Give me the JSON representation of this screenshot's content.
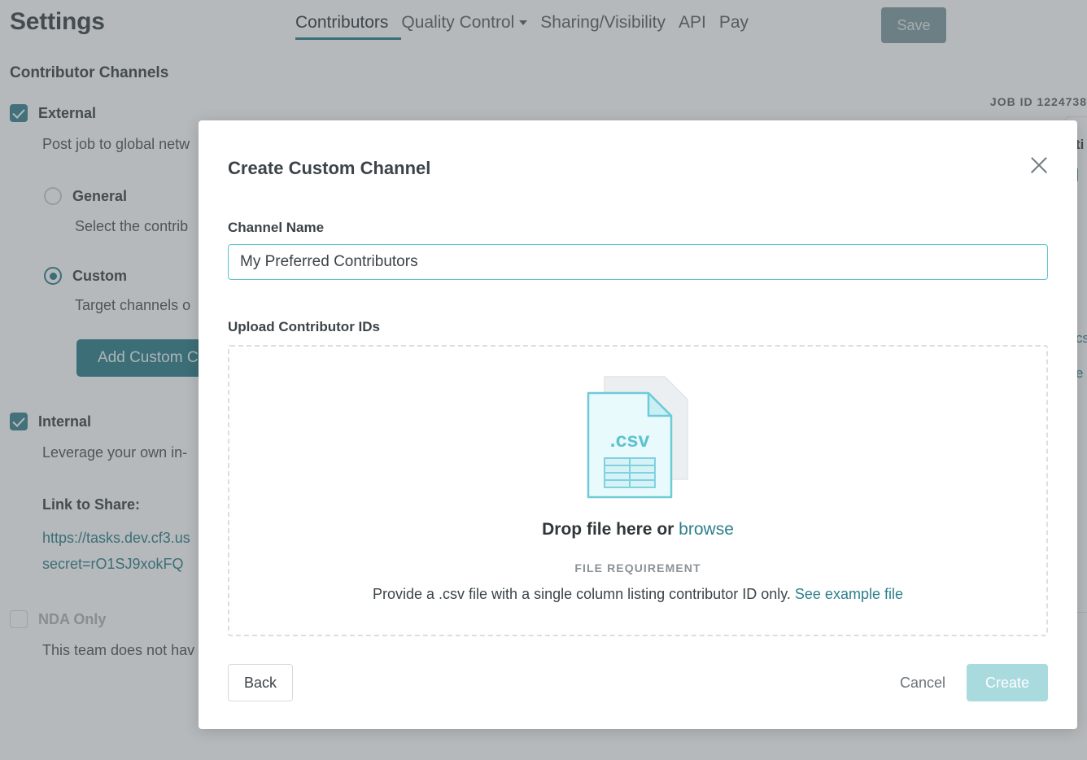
{
  "page": {
    "title": "Settings",
    "section_title": "Contributor Channels",
    "job_id": "JOB ID 1224738",
    "save_label": "Save",
    "accent_color": "#2d7f8c",
    "scrim_color": "#50595e"
  },
  "tabs": [
    {
      "label": "Contributors",
      "active": true,
      "caret": false
    },
    {
      "label": "Quality Control",
      "active": false,
      "caret": true
    },
    {
      "label": "Sharing/Visibility",
      "active": false,
      "caret": false
    },
    {
      "label": "API",
      "active": false,
      "caret": false
    },
    {
      "label": "Pay",
      "active": false,
      "caret": false
    }
  ],
  "background": {
    "external": {
      "label": "External",
      "checked": true,
      "desc": "Post job to global netw"
    },
    "general": {
      "label": "General",
      "selected": false,
      "desc": "Select the contrib"
    },
    "custom": {
      "label": "Custom",
      "selected": true,
      "desc": "Target channels o"
    },
    "add_custom_button": "Add Custom Ch",
    "internal": {
      "label": "Internal",
      "checked": true,
      "desc": "Leverage your own in-"
    },
    "link_to_share_label": "Link to Share:",
    "share_link_line1": "https://tasks.dev.cf3.us",
    "share_link_line2": "secret=rO1SJ9xokFQ",
    "nda_only": {
      "label": "NDA Only",
      "checked": false,
      "desc": "This team does not hav"
    },
    "right_panel": {
      "line1": "ti",
      "line2": "|",
      "line3": "cs",
      "line4": "e"
    }
  },
  "modal": {
    "title": "Create Custom Channel",
    "close_icon": "close-icon",
    "channel_name_label": "Channel Name",
    "channel_name_value": "My Preferred Contributors",
    "channel_name_placeholder": "Channel Name",
    "upload_label": "Upload Contributor IDs",
    "csv_icon_text": ".csv",
    "drop_text": "Drop file here or",
    "browse_text": "browse",
    "requirement_heading": "FILE REQUIREMENT",
    "requirement_text": "Provide a .csv file with a single column listing contributor ID only.",
    "see_example_text": "See example file",
    "back_label": "Back",
    "cancel_label": "Cancel",
    "create_label": "Create"
  }
}
